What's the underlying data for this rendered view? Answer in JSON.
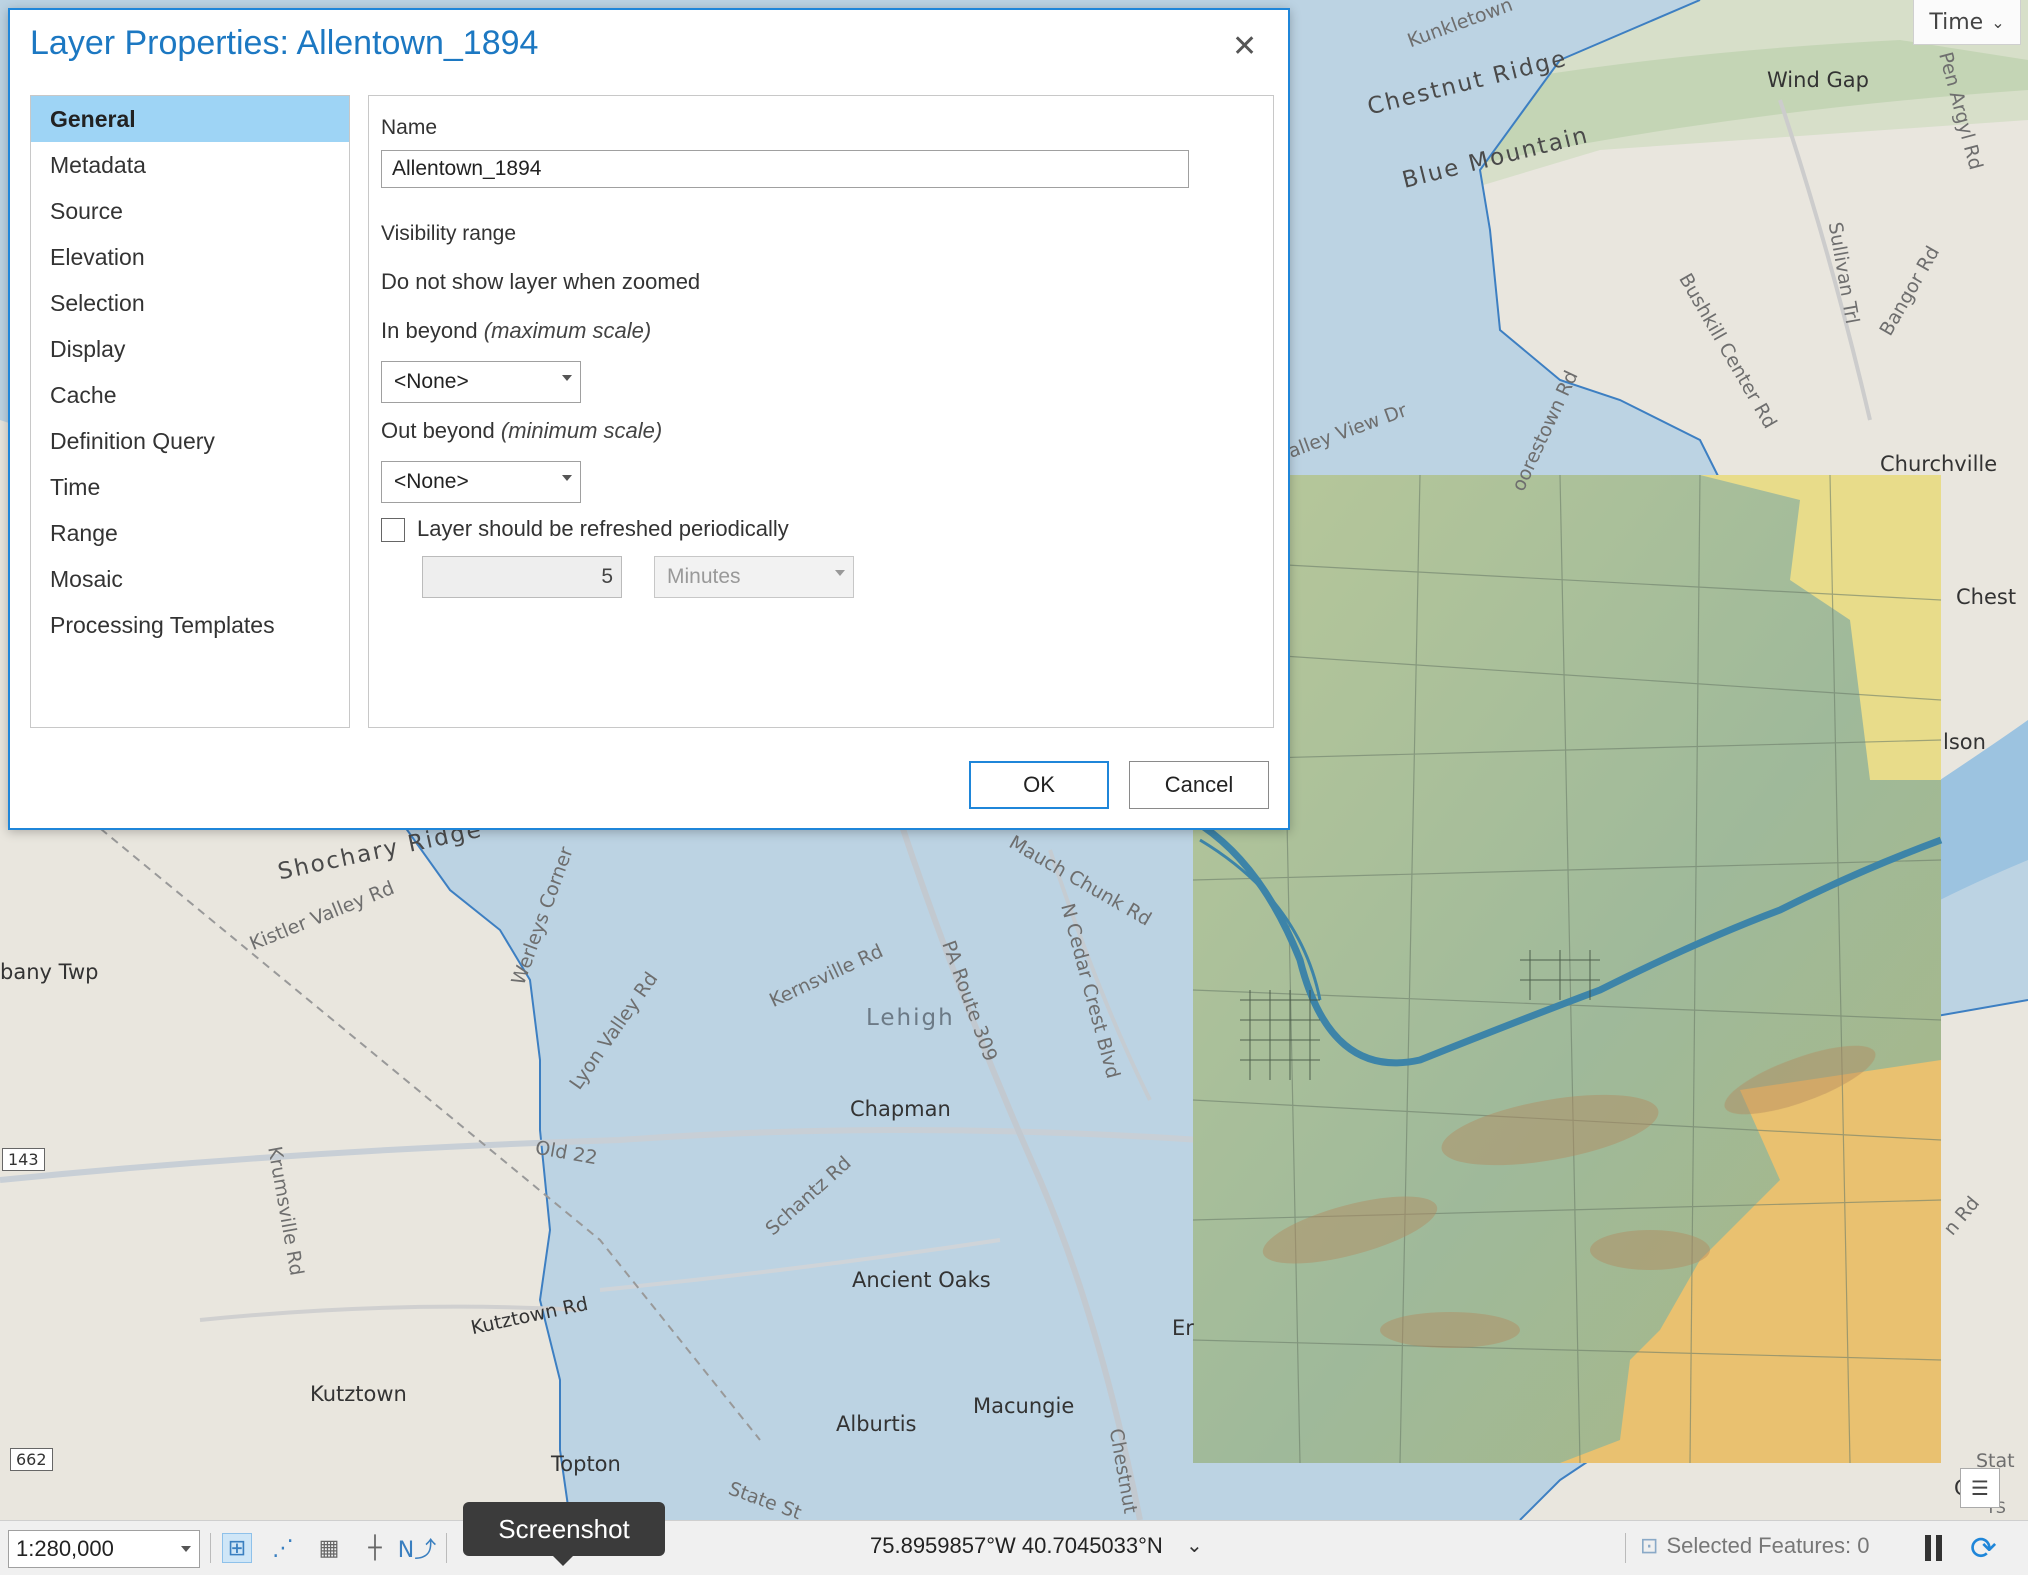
{
  "dialog": {
    "title": "Layer Properties: Allentown_1894",
    "close_glyph": "✕",
    "nav_items": [
      {
        "label": "General"
      },
      {
        "label": "Metadata"
      },
      {
        "label": "Source"
      },
      {
        "label": "Elevation"
      },
      {
        "label": "Selection"
      },
      {
        "label": "Display"
      },
      {
        "label": "Cache"
      },
      {
        "label": "Definition Query"
      },
      {
        "label": "Time"
      },
      {
        "label": "Range"
      },
      {
        "label": "Mosaic"
      },
      {
        "label": "Processing Templates"
      }
    ],
    "active_nav": "General",
    "general": {
      "name_label": "Name",
      "name_value": "Allentown_1894",
      "visibility_heading": "Visibility range",
      "visibility_sub": "Do not show layer when zoomed",
      "in_beyond_label": "In beyond",
      "in_beyond_hint": "(maximum scale)",
      "in_beyond_value": "<None>",
      "out_beyond_label": "Out beyond",
      "out_beyond_hint": "(minimum scale)",
      "out_beyond_value": "<None>",
      "refresh_label": "Layer should be refreshed periodically",
      "refresh_checked": false,
      "refresh_interval": "5",
      "refresh_unit": "Minutes"
    },
    "ok_label": "OK",
    "cancel_label": "Cancel"
  },
  "map": {
    "time_label": "Time",
    "labels": {
      "kunkletown": "Kunkletown",
      "chestnut_ridge": "Chestnut Ridge",
      "blue_mountain": "Blue Mountain",
      "wind_gap": "Wind Gap",
      "pen_argyl_rd": "Pen Argyl Rd",
      "sullivan_trl": "Sullivan Trl",
      "bangor_rd": "Bangor Rd",
      "bushkill_center_rd": "Bushkill Center Rd",
      "valley_view_dr": "alley View Dr",
      "moorestown_rd": "oorestown Rd",
      "churchville": "Churchville",
      "chest": "Chest",
      "lson": "lson",
      "shochary_ridge": "Shochary Ridge",
      "kistler_valley_rd": "Kistler Valley Rd",
      "bany_twp": "bany Twp",
      "werleys_corner": "Werleys Corner",
      "lyon_valley_rd": "Lyon Valley Rd",
      "kernsville_rd": "Kernsville Rd",
      "lehigh": "Lehigh",
      "pa_route_309": "PA Route 309",
      "mauch_chunk_rd": "Mauch Chunk Rd",
      "cedar_crest_blvd": "N Cedar Crest Blvd",
      "chapman": "Chapman",
      "old_22": "Old 22",
      "schantz_rd": "Schantz Rd",
      "ancient_oaks": "Ancient Oaks",
      "krumsville_rd": "Krumsville Rd",
      "kutztown_rd": "Kutztown Rd",
      "kutztown": "Kutztown",
      "alburtis": "Alburtis",
      "macungie": "Macungie",
      "topton": "Topton",
      "state_st": "State St",
      "chestnut": "Chestnut",
      "er": "Er",
      "n_rd": "n Rd",
      "route_143": "143",
      "route_662": "662",
      "stat": "Stat",
      "ga": "Ga",
      "ts": "TS"
    }
  },
  "status_bar": {
    "scale": "1:280,000",
    "coordinates": "75.8959857°W 40.7045033°N",
    "selected_features": "Selected Features: 0",
    "tooltip": "Screenshot"
  }
}
